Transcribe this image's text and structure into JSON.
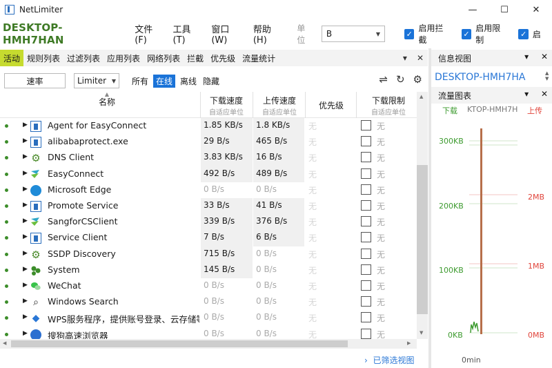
{
  "window": {
    "title": "NetLimiter",
    "controls": [
      "—",
      "☐",
      "✕"
    ]
  },
  "topbar": {
    "host": "DESKTOP-HMH7HAN",
    "menu": [
      "文件(F)",
      "工具(T)",
      "窗口(W)",
      "帮助(H)"
    ],
    "unit_label": "单位",
    "unit_value": "B",
    "checks": [
      {
        "label": "启用拦截",
        "checked": true
      },
      {
        "label": "启用限制",
        "checked": true
      },
      {
        "label": "启",
        "checked": true
      }
    ]
  },
  "tabs": {
    "items": [
      "活动",
      "规则列表",
      "过滤列表",
      "应用列表",
      "网络列表",
      "拦截",
      "优先级",
      "流量统计"
    ],
    "active": 0
  },
  "filterbar": {
    "speed_button": "速率",
    "limiter_value": "Limiter",
    "filters": [
      "所有",
      "在线",
      "离线",
      "隐藏"
    ],
    "active_filter": 1
  },
  "table": {
    "columns": {
      "name": "名称",
      "download": "下载速度",
      "download_sub": "自适应单位",
      "upload": "上传速度",
      "upload_sub": "自适应单位",
      "priority": "优先级",
      "dl_limit": "下载限制",
      "dl_limit_sub": "自适应单位"
    },
    "rows": [
      {
        "name": "Agent for EasyConnect",
        "icon": "window-icon",
        "download": "1.85 KB/s",
        "upload": "1.8 KB/s",
        "priority": "无",
        "limit": "无"
      },
      {
        "name": "alibabaprotect.exe",
        "icon": "window-icon",
        "download": "29 B/s",
        "upload": "465 B/s",
        "priority": "无",
        "limit": "无"
      },
      {
        "name": "DNS Client",
        "icon": "gear-icon",
        "download": "3.83 KB/s",
        "upload": "16 B/s",
        "priority": "无",
        "limit": "无"
      },
      {
        "name": "EasyConnect",
        "icon": "sangfor-icon",
        "download": "492 B/s",
        "upload": "489 B/s",
        "priority": "无",
        "limit": "无"
      },
      {
        "name": "Microsoft Edge",
        "icon": "edge-icon",
        "download": "0 B/s",
        "upload": "0 B/s",
        "priority": "无",
        "limit": "无"
      },
      {
        "name": "Promote Service",
        "icon": "window-icon",
        "download": "33 B/s",
        "upload": "41 B/s",
        "priority": "无",
        "limit": "无"
      },
      {
        "name": "SangforCSClient",
        "icon": "sangfor-icon",
        "download": "339 B/s",
        "upload": "376 B/s",
        "priority": "无",
        "limit": "无"
      },
      {
        "name": "Service Client",
        "icon": "window-icon",
        "download": "7 B/s",
        "upload": "6 B/s",
        "priority": "无",
        "limit": "无"
      },
      {
        "name": "SSDP Discovery",
        "icon": "gear-icon",
        "download": "715 B/s",
        "upload": "0 B/s",
        "priority": "无",
        "limit": "无"
      },
      {
        "name": "System",
        "icon": "system-icon",
        "download": "145 B/s",
        "upload": "0 B/s",
        "priority": "无",
        "limit": "无"
      },
      {
        "name": "WeChat",
        "icon": "wechat-icon",
        "download": "0 B/s",
        "upload": "0 B/s",
        "priority": "无",
        "limit": "无"
      },
      {
        "name": "Windows Search",
        "icon": "search-icon",
        "download": "0 B/s",
        "upload": "0 B/s",
        "priority": "无",
        "limit": "无"
      },
      {
        "name": "WPS服务程序，提供账号登录、云存储等",
        "icon": "wps-icon",
        "download": "0 B/s",
        "upload": "0 B/s",
        "priority": "无",
        "limit": "无"
      },
      {
        "name": "搜狗高速浏览器",
        "icon": "sogou-icon",
        "download": "0 B/s",
        "upload": "0 B/s",
        "priority": "无",
        "limit": "无"
      }
    ]
  },
  "footer": {
    "filtered_view": "已筛选视图"
  },
  "info_panel": {
    "title": "信息视图",
    "host": "DESKTOP-HMH7HA"
  },
  "traffic_panel": {
    "title": "流量图表",
    "legend_download": "下载",
    "legend_host": "KTOP-HMH7H",
    "legend_upload": "上传",
    "left_ticks": [
      "300KB",
      "200KB",
      "100KB",
      "0KB"
    ],
    "right_ticks": [
      "2MB",
      "1MB",
      "0MB"
    ],
    "x_label": "0min",
    "download_color": "#3c9a2e",
    "upload_color": "#e0433a"
  }
}
